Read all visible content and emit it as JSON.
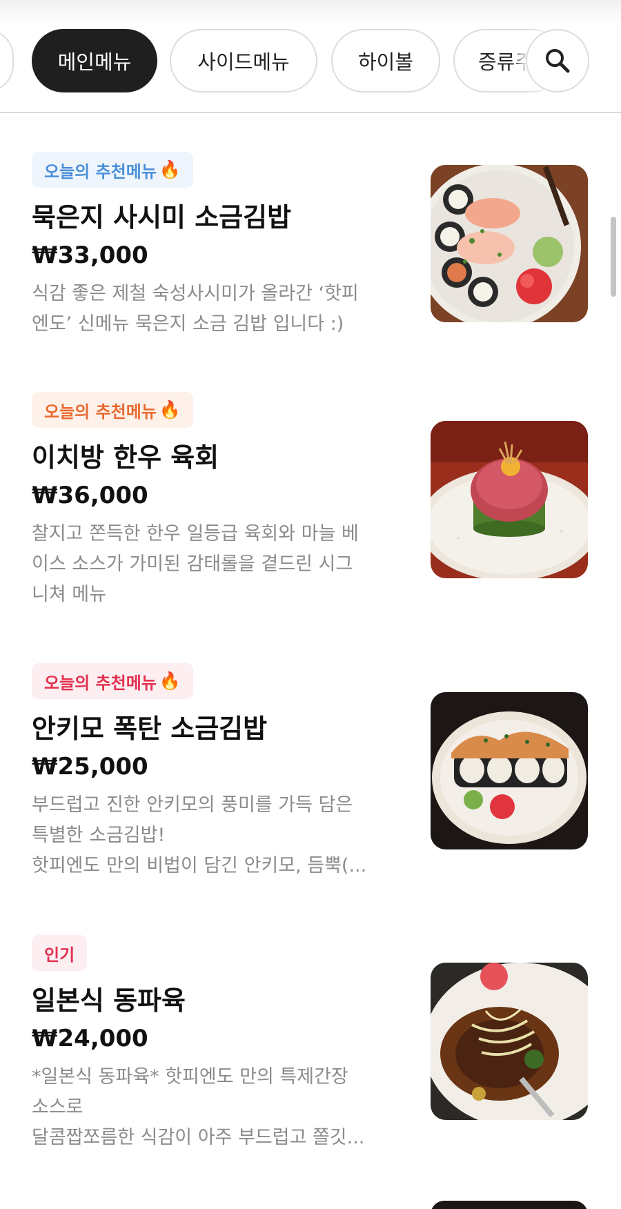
{
  "categories": {
    "tabs": [
      {
        "label": "메인메뉴",
        "active": true
      },
      {
        "label": "사이드메뉴",
        "active": false
      },
      {
        "label": "하이볼",
        "active": false
      },
      {
        "label": "증류주",
        "active": false
      }
    ],
    "search_icon": "search-icon"
  },
  "menu": [
    {
      "badge": "오늘의 추천메뉴",
      "badge_emoji": "🔥",
      "badge_color": "#4a8fd8",
      "badge_bg": "#eef5fd",
      "name": "묵은지 사시미 소금김밥",
      "price": "₩33,000",
      "desc_lines": [
        "식감 좋은 제철 숙성사시미가 올라간 ‘핫피",
        "엔도’ 신메뉴 묵은지 소금 김밥 입니다 :)"
      ]
    },
    {
      "badge": "오늘의 추천메뉴",
      "badge_emoji": "🔥",
      "badge_color": "#e8692f",
      "badge_bg": "#fdf1ea",
      "name": "이치방 한우 육회",
      "price": "₩36,000",
      "desc_lines": [
        "찰지고 쫀득한 한우 일등급 육회와 마늘 베",
        "이스 소스가 가미된 감태롤을 곁드린 시그",
        "니쳐 메뉴"
      ]
    },
    {
      "badge": "오늘의 추천메뉴",
      "badge_emoji": "🔥",
      "badge_color": "#e2304f",
      "badge_bg": "#fdeef1",
      "name": "안키모 폭탄 소금김밥",
      "price": "₩25,000",
      "desc_lines": [
        "부드럽고 진한 안키모의 풍미를 가득 담은",
        "특별한 소금김밥!",
        "핫피엔도 만의 비법이 담긴 안키모, 듬뿍(..."
      ]
    },
    {
      "badge": "인기",
      "badge_emoji": "",
      "badge_color": "#e2304f",
      "badge_bg": "#fdeef1",
      "name": "일본식 동파육",
      "price": "₩24,000",
      "desc_lines": [
        "*일본식 동파육* 핫피엔도 만의 특제간장",
        "소스로",
        "달콤짭쪼름한 식감이 아주 부드럽고 쫄깃..."
      ]
    }
  ]
}
